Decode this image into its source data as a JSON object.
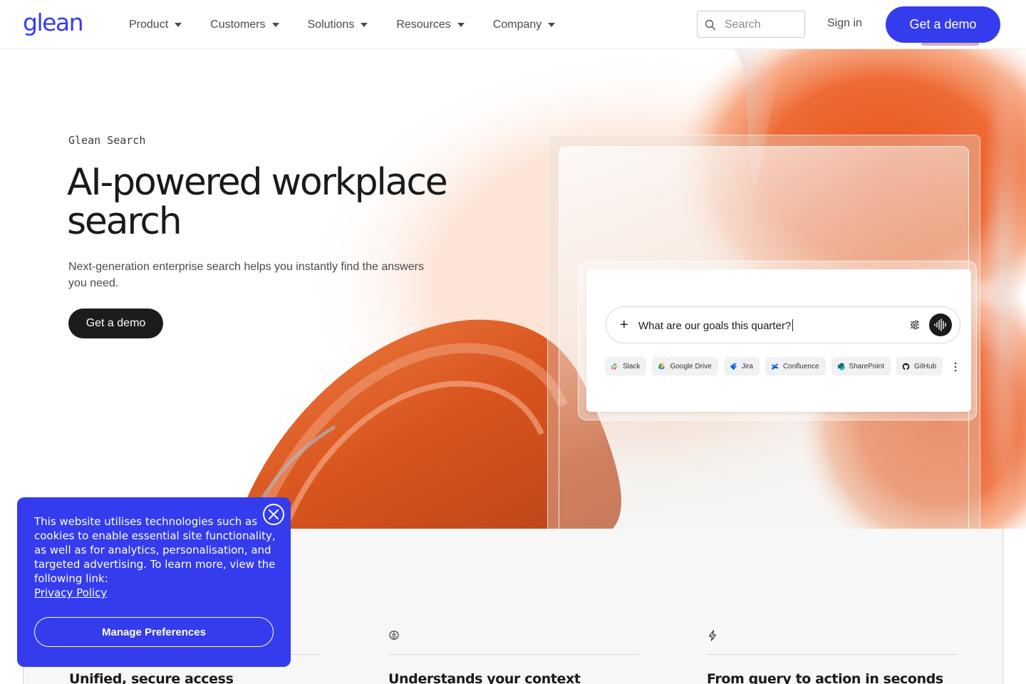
{
  "brand": {
    "logo_text": "glean",
    "accent": "#343ced"
  },
  "nav": {
    "items": [
      {
        "label": "Product"
      },
      {
        "label": "Customers"
      },
      {
        "label": "Solutions"
      },
      {
        "label": "Resources"
      },
      {
        "label": "Company"
      }
    ],
    "search": {
      "placeholder": "Search",
      "icon": "search-icon"
    },
    "sign_in": "Sign in",
    "cta": "Get a demo"
  },
  "hero": {
    "eyebrow": "Glean Search",
    "headline": "AI-powered workplace search",
    "subhead": "Next-generation enterprise search helps you instantly find the answers you need.",
    "cta": "Get a demo"
  },
  "mock": {
    "query": "What are our goals this quarter?",
    "chips": [
      {
        "label": "Slack",
        "icon": "slack-icon"
      },
      {
        "label": "Google Drive",
        "icon": "google-drive-icon"
      },
      {
        "label": "Jira",
        "icon": "jira-icon"
      },
      {
        "label": "Confluence",
        "icon": "confluence-icon"
      },
      {
        "label": "SharePoint",
        "icon": "sharepoint-icon"
      },
      {
        "label": "GitHub",
        "icon": "github-icon"
      }
    ]
  },
  "features": [
    {
      "icon": "shield-icon",
      "title": "Unified, secure access"
    },
    {
      "icon": "brain-icon",
      "title": "Understands your context"
    },
    {
      "icon": "lightning-icon",
      "title": "From query to action in seconds"
    }
  ],
  "cookie": {
    "text": "This website utilises technologies such as cookies to enable essential site functionality, as well as for analytics, personalisation, and targeted advertising. To learn more, view the following link:",
    "link": "Privacy Policy",
    "button": "Manage Preferences"
  }
}
